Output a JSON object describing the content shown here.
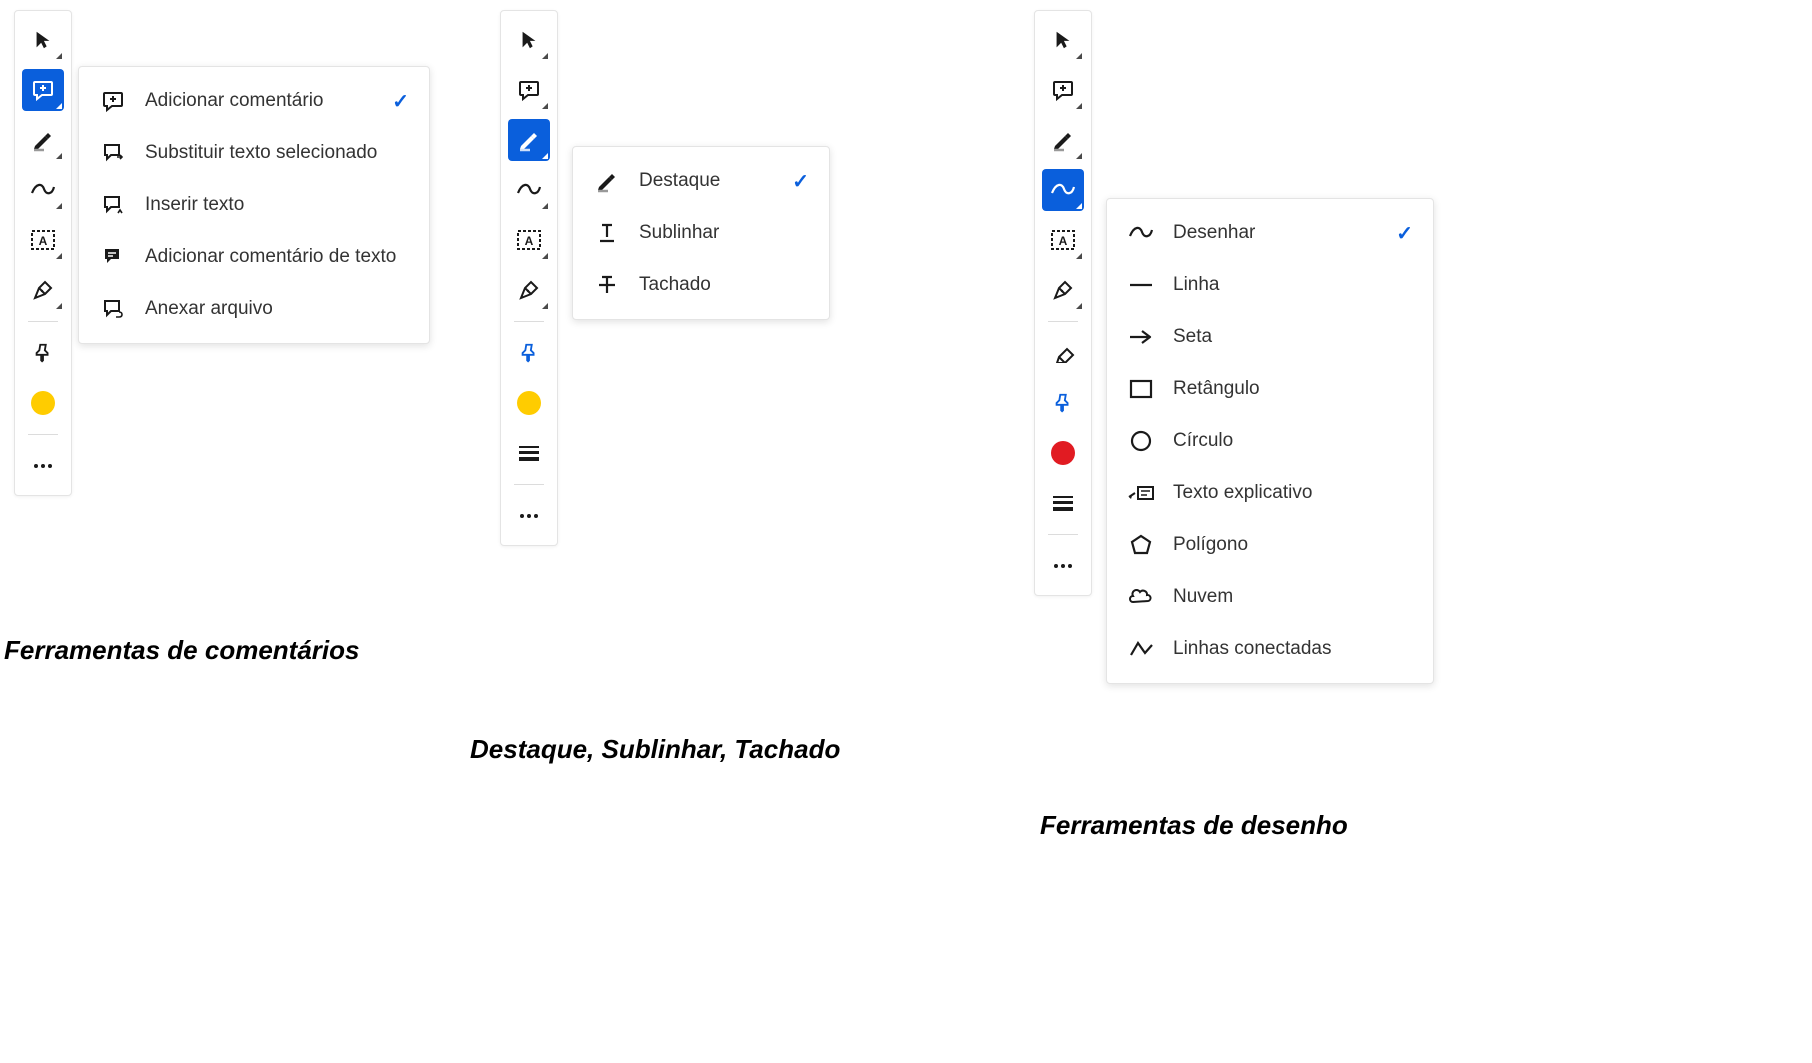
{
  "panel1": {
    "caption": "Ferramentas de comentários",
    "color": "#ffcc00",
    "flyout": [
      {
        "label": "Adicionar comentário",
        "checked": true
      },
      {
        "label": "Substituir texto selecionado",
        "checked": false
      },
      {
        "label": "Inserir texto",
        "checked": false
      },
      {
        "label": "Adicionar comentário de texto",
        "checked": false
      },
      {
        "label": "Anexar arquivo",
        "checked": false
      }
    ]
  },
  "panel2": {
    "caption": "Destaque, Sublinhar, Tachado",
    "color": "#ffcc00",
    "flyout": [
      {
        "label": "Destaque",
        "checked": true
      },
      {
        "label": "Sublinhar",
        "checked": false
      },
      {
        "label": "Tachado",
        "checked": false
      }
    ]
  },
  "panel3": {
    "caption": "Ferramentas de desenho",
    "color": "#e11b22",
    "flyout": [
      {
        "label": "Desenhar",
        "checked": true
      },
      {
        "label": "Linha",
        "checked": false
      },
      {
        "label": "Seta",
        "checked": false
      },
      {
        "label": "Retângulo",
        "checked": false
      },
      {
        "label": "Círculo",
        "checked": false
      },
      {
        "label": "Texto explicativo",
        "checked": false
      },
      {
        "label": "Polígono",
        "checked": false
      },
      {
        "label": "Nuvem",
        "checked": false
      },
      {
        "label": "Linhas conectadas",
        "checked": false
      }
    ]
  }
}
